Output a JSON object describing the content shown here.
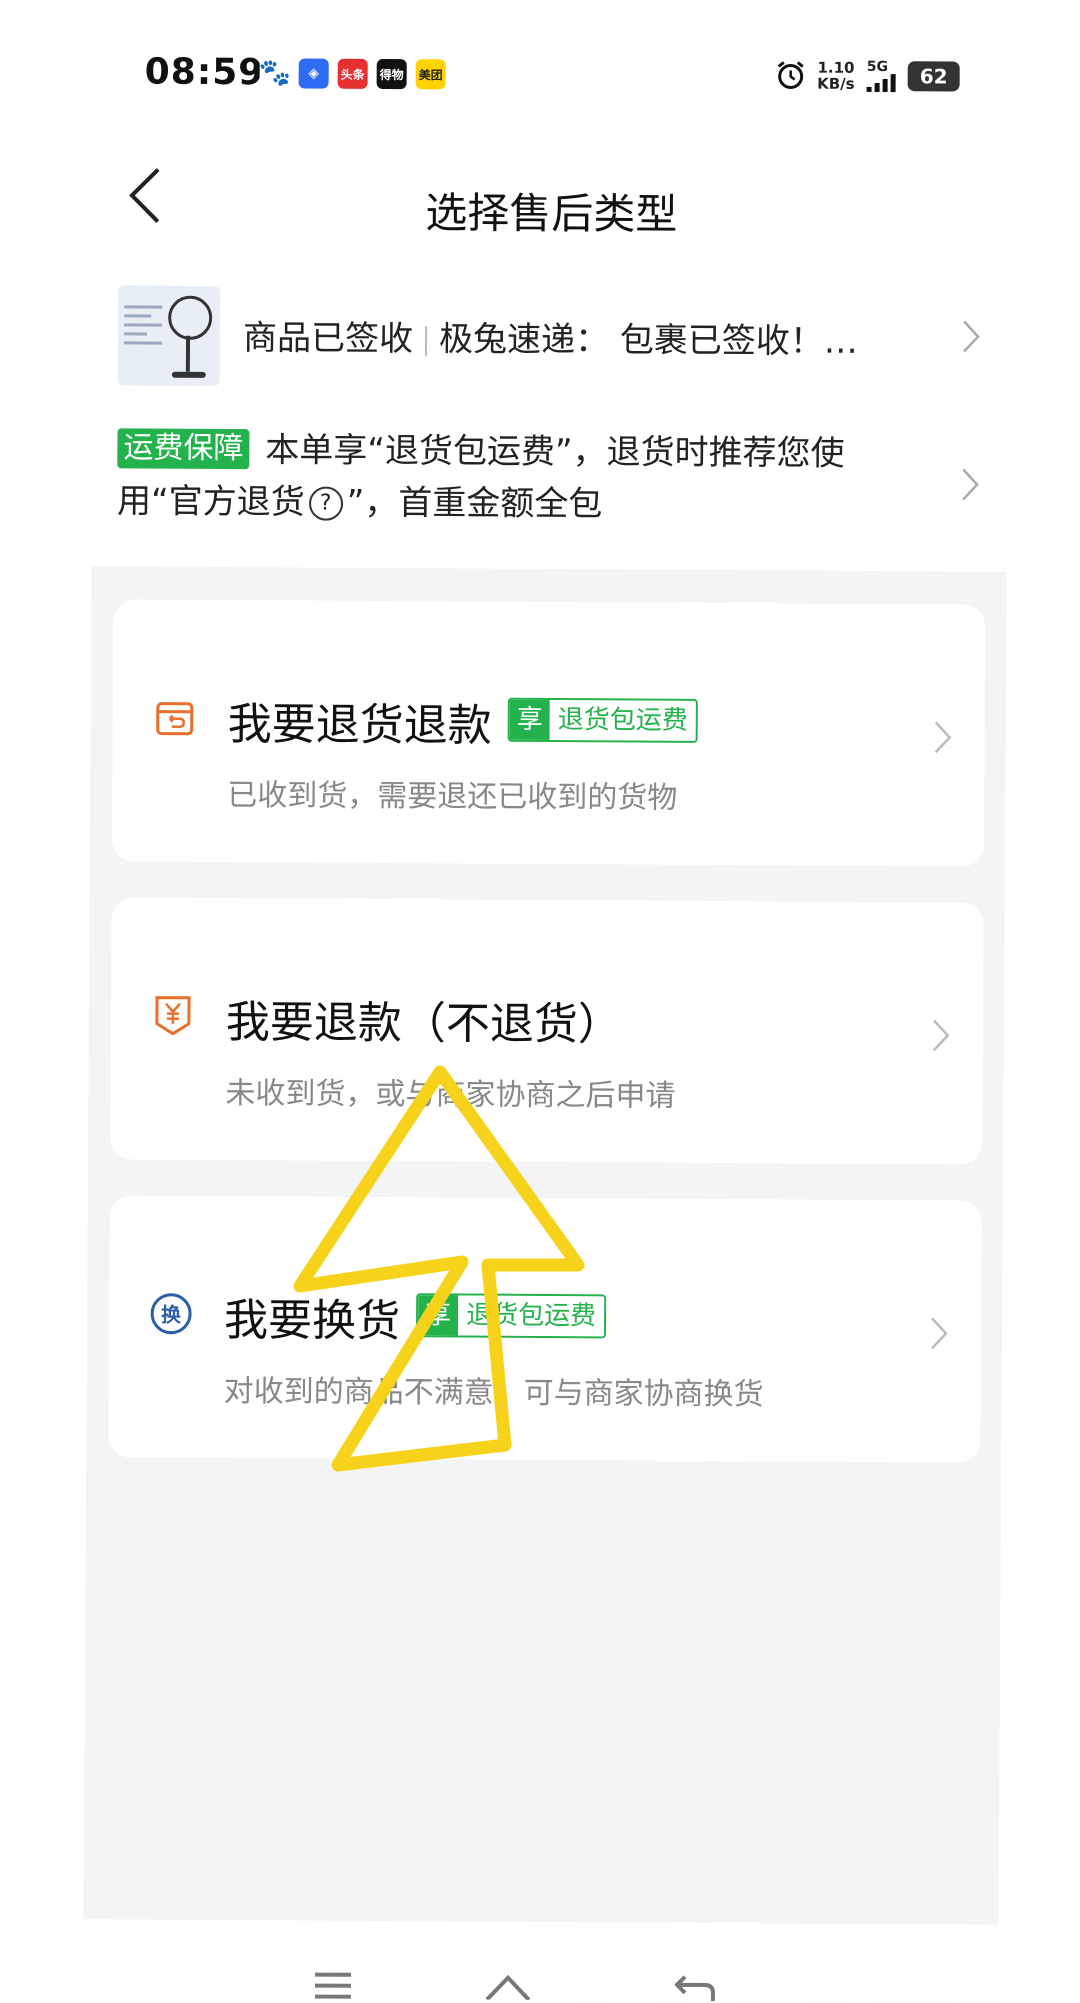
{
  "status_bar": {
    "time": "08:59",
    "apps": [
      {
        "name": "baidu",
        "glyph": "🐾"
      },
      {
        "name": "browser",
        "glyph": "◈"
      },
      {
        "name": "toutiao",
        "glyph": "头条"
      },
      {
        "name": "dewu",
        "glyph": "得物"
      },
      {
        "name": "meituan",
        "glyph": "美团"
      }
    ],
    "net_speed_value": "1.10",
    "net_speed_unit": "KB/s",
    "network_type": "5G",
    "battery": "62"
  },
  "header": {
    "title": "选择售后类型"
  },
  "product": {
    "status": "商品已签收",
    "logistics": "极兔速递： 包裹已签收！…"
  },
  "shipping_notice": {
    "badge": "运费保障",
    "text_before": "本单享“退货包运费”，退货时推荐您使用“官方退货",
    "help_glyph": "?",
    "text_after": "”，首重金额全包"
  },
  "options": [
    {
      "title": "我要退货退款",
      "tag_prefix": "享",
      "tag_text": "退货包运费",
      "desc": "已收到货，需要退还已收到的货物",
      "icon": "return-box-icon"
    },
    {
      "title": "我要退款（不退货）",
      "desc": "未收到货，或与商家协商之后申请",
      "icon": "refund-yen-icon"
    },
    {
      "title": "我要换货",
      "tag_prefix": "享",
      "tag_text": "退货包运费",
      "desc": "对收到的商品不满意，可与商家协商换货",
      "icon_text": "换",
      "icon": "exchange-icon"
    }
  ],
  "colors": {
    "green": "#23b24b",
    "orange_icon": "#e8702a",
    "blue_icon": "#2b5ea8",
    "annotation_yellow": "#f7d21a"
  }
}
